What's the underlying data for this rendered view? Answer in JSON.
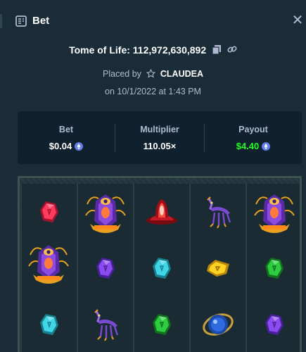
{
  "modal": {
    "title": "Bet",
    "title_icon": "bet-slip-icon",
    "close_icon": "close-icon"
  },
  "game": {
    "name_and_id": "Tome of Life: 112,972,630,892",
    "copy_icon": "copy-icon",
    "link_icon": "link-icon"
  },
  "placed": {
    "prefix": "Placed by",
    "user_icon": "star-icon",
    "username": "CLAUDEA",
    "date": "on 10/1/2022 at 1:43 PM"
  },
  "stats": {
    "bet_label": "Bet",
    "bet_value": "$0.04",
    "multiplier_label": "Multiplier",
    "multiplier_value": "110.05×",
    "payout_label": "Payout",
    "payout_value": "$4.40",
    "currency_icon": "ethereum-coin-icon"
  },
  "colors": {
    "background": "#1a2c38",
    "panel": "#0f212e",
    "muted_text": "#b1bad3",
    "payout_green": "#1fff20",
    "coin_blue": "#627eea"
  },
  "reels": [
    [
      "red-gem-icon",
      "purple-gem-icon",
      "cyan-gem-icon"
    ],
    [
      "priestess-wild-icon",
      "purple-gem-icon",
      "jackal-creature-icon"
    ],
    [
      "red-shrine-icon",
      "cyan-gem-icon",
      "green-gem-icon"
    ],
    [
      "jackal-creature-icon",
      "yellow-gem-icon",
      "blue-orb-icon"
    ],
    [
      "priestess-wild-icon",
      "green-gem-icon",
      "purple-gem-icon"
    ]
  ],
  "reel_extra": {
    "priestess_overflow_col": 0,
    "note_icon": "priestess-wild-icon"
  }
}
